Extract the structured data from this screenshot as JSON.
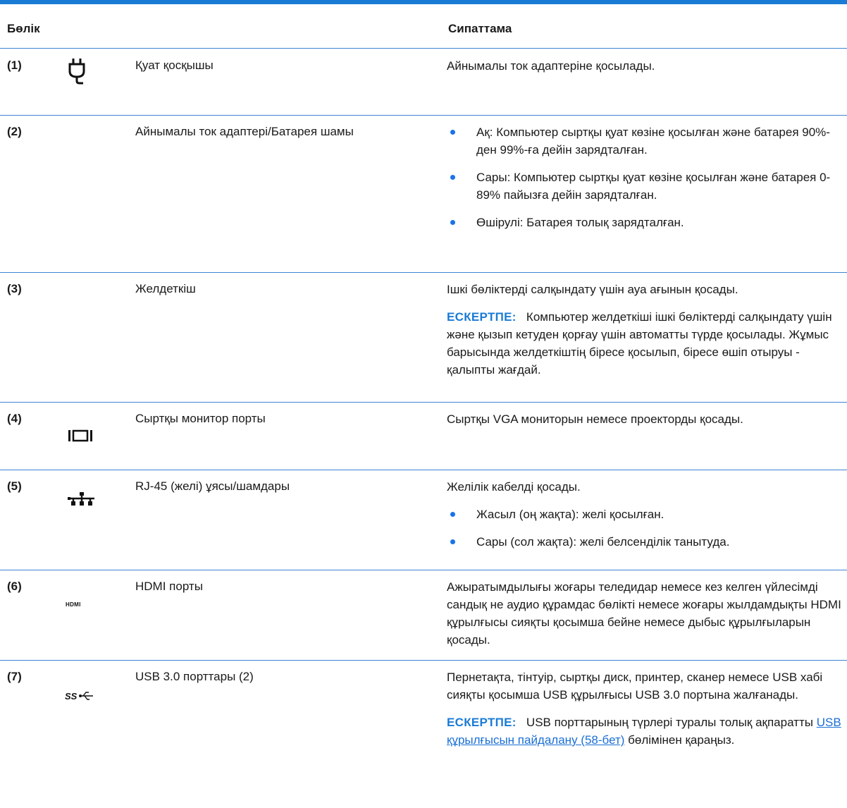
{
  "header": {
    "col1": "Бөлік",
    "col2": "Сипаттама"
  },
  "note_label": "ЕСКЕРТПЕ:",
  "rows": [
    {
      "num": "(1)",
      "icon": "power-plug-icon",
      "name": "Қуат қосқышы",
      "desc": "Айнымалы ток адаптеріне қосылады."
    },
    {
      "num": "(2)",
      "icon": "",
      "name": "Айнымалы ток адаптері/Батарея шамы",
      "bullets": [
        "Ақ: Компьютер сыртқы қуат көзіне қосылған және батарея 90%-ден 99%-ға дейін зарядталған.",
        "Сары: Компьютер сыртқы қуат көзіне қосылған және батарея 0-89% пайызға дейін зарядталған.",
        "Өшірулі: Батарея толық зарядталған."
      ]
    },
    {
      "num": "(3)",
      "icon": "",
      "name": "Желдеткіш",
      "desc": "Ішкі бөліктерді салқындату үшін ауа ағынын қосады.",
      "note": "Компьютер желдеткіші ішкі бөліктерді салқындату үшін және қызып кетуден қорғау үшін автоматты түрде қосылады. Жұмыс барысында желдеткіштің біресе қосылып, біресе өшіп отыруы - қалыпты жағдай."
    },
    {
      "num": "(4)",
      "icon": "vga-monitor-port-icon",
      "name": "Сыртқы монитор порты",
      "desc": "Сыртқы VGA мониторын немесе проекторды қосады."
    },
    {
      "num": "(5)",
      "icon": "network-icon",
      "name": "RJ-45 (желі) ұясы/шамдары",
      "desc": "Желілік кабелді қосады.",
      "bullets": [
        "Жасыл (оң жақта): желі қосылған.",
        "Сары (сол жақта): желі белсенділік танытуда."
      ]
    },
    {
      "num": "(6)",
      "icon": "hdmi-icon",
      "name": "HDMI порты",
      "desc": "Ажыратымдылығы жоғары теледидар немесе кез келген үйлесімді сандық не аудио құрамдас бөлікті немесе жоғары жылдамдықты HDMI құрылғысы сияқты қосымша бейне немесе дыбыс құрылғыларын қосады."
    },
    {
      "num": "(7)",
      "icon": "usb-superspeed-icon",
      "name": "USB 3.0 порттары (2)",
      "desc": "Пернетақта, тінтуір, сыртқы диск, принтер, сканер немесе USB хабі сияқты қосымша USB құрылғысы USB 3.0 портына жалғанады.",
      "note_pre": "USB порттарының түрлері туралы толық ақпаратты ",
      "note_link": "USB құрылғысын пайдалану (58-бет)",
      "note_post": " бөлімінен қараңыз."
    }
  ],
  "colors": {
    "accent": "#1a7bd6",
    "rule": "#3d84d4",
    "bullet": "#1a73e8"
  }
}
